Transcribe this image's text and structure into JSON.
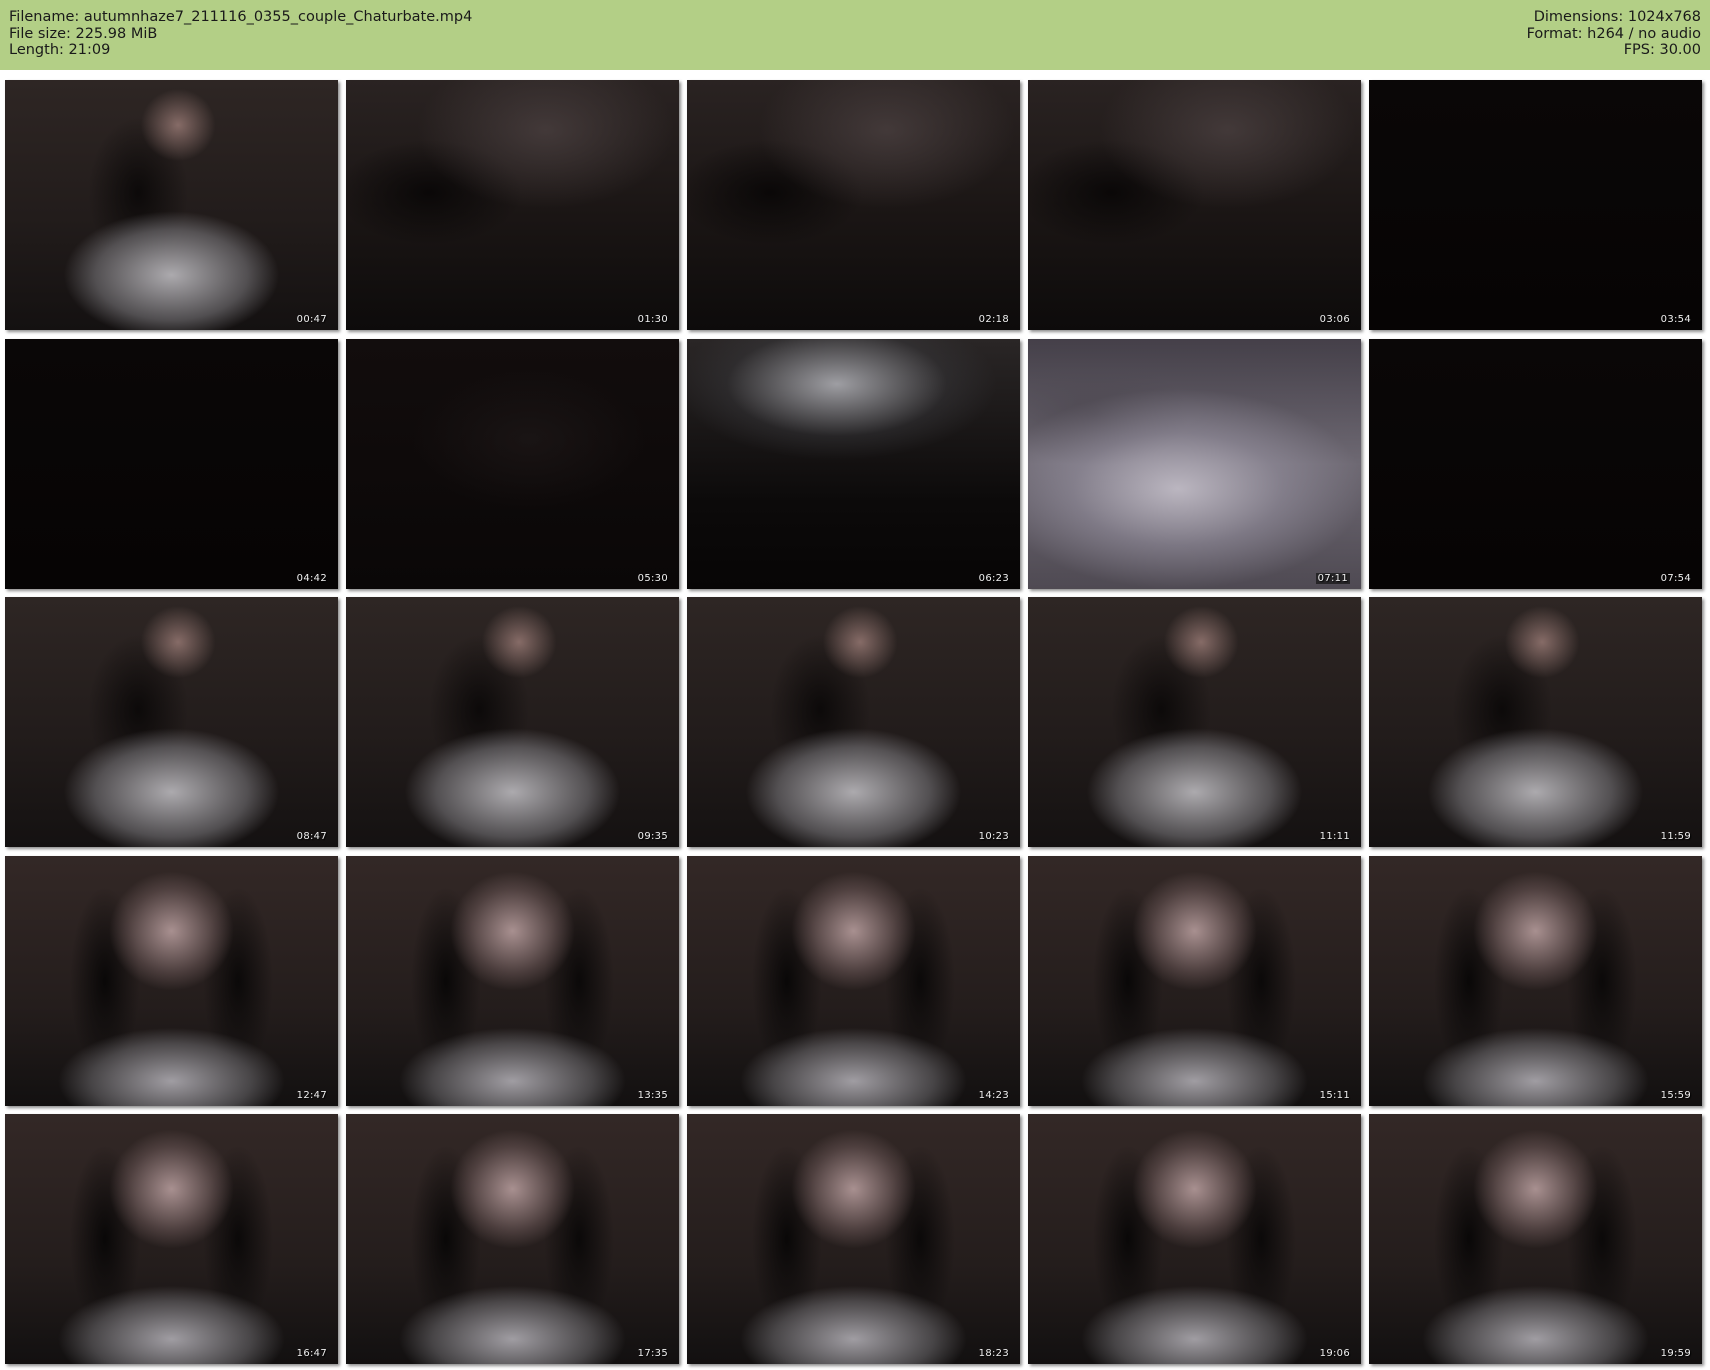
{
  "header": {
    "filename": "Filename: autumnhaze7_211116_0355_couple_Chaturbate.mp4",
    "filesize": "File size: 225.98 MiB",
    "length": "Length: 21:09",
    "dimensions": "Dimensions: 1024x768",
    "format": "Format: h264 / no audio",
    "fps": "FPS: 30.00"
  },
  "colors": {
    "header_bg": "#b3cf86",
    "page_bg": "#ffffff"
  },
  "thumbnails": [
    {
      "time": "00:47"
    },
    {
      "time": "01:30"
    },
    {
      "time": "02:18"
    },
    {
      "time": "03:06"
    },
    {
      "time": "03:54"
    },
    {
      "time": "04:42"
    },
    {
      "time": "05:30"
    },
    {
      "time": "06:23"
    },
    {
      "time": "07:11"
    },
    {
      "time": "07:54"
    },
    {
      "time": "08:47"
    },
    {
      "time": "09:35"
    },
    {
      "time": "10:23"
    },
    {
      "time": "11:11"
    },
    {
      "time": "11:59"
    },
    {
      "time": "12:47"
    },
    {
      "time": "13:35"
    },
    {
      "time": "14:23"
    },
    {
      "time": "15:11"
    },
    {
      "time": "15:59"
    },
    {
      "time": "16:47"
    },
    {
      "time": "17:35"
    },
    {
      "time": "18:23"
    },
    {
      "time": "19:06"
    },
    {
      "time": "19:59"
    }
  ]
}
